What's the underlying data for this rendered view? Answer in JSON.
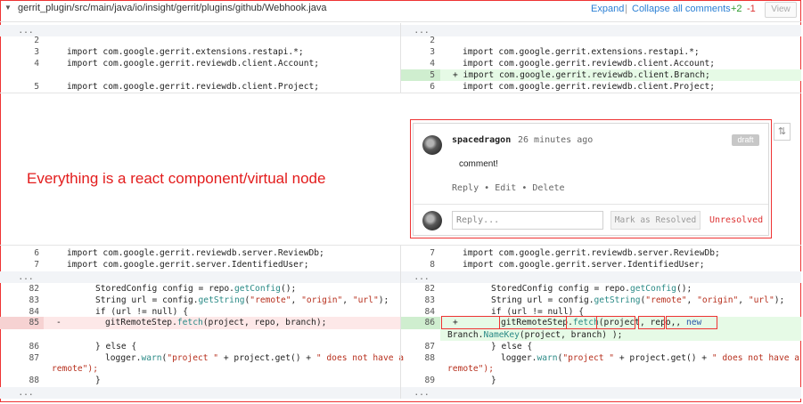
{
  "header": {
    "file_path": "gerrit_plugin/src/main/java/io/insight/gerrit/plugins/github/Webhook.java",
    "expand_label": "Expand",
    "separator": "|",
    "collapse_label": "Collapse all comments",
    "additions": "+2",
    "deletions": "-1",
    "view_label": "View"
  },
  "skip_label": "...",
  "left": {
    "lines": [
      {
        "n": "2",
        "code": ""
      },
      {
        "n": "3",
        "code": "import com.google.gerrit.extensions.restapi.*;"
      },
      {
        "n": "4",
        "code": "import com.google.gerrit.reviewdb.client.Account;"
      },
      {
        "n": "5",
        "code": "import com.google.gerrit.reviewdb.client.Project;"
      },
      {
        "n": "6",
        "code": "import com.google.gerrit.reviewdb.server.ReviewDb;"
      },
      {
        "n": "7",
        "code": "import com.google.gerrit.server.IdentifiedUser;"
      },
      {
        "n": "82",
        "code": "StoredConfig config = repo."
      },
      {
        "n": "83",
        "code": "String url = config."
      },
      {
        "n": "84",
        "code": "if (url != null) {"
      },
      {
        "n": "85",
        "code": "gitRemoteStep."
      },
      {
        "n": "86",
        "code": "} else {"
      },
      {
        "n": "87",
        "code": "logger."
      },
      {
        "n": "88",
        "code": "}"
      }
    ]
  },
  "right": {
    "lines": [
      {
        "n": "2",
        "code": ""
      },
      {
        "n": "3",
        "code": "import com.google.gerrit.extensions.restapi.*;"
      },
      {
        "n": "4",
        "code": "import com.google.gerrit.reviewdb.client.Account;"
      },
      {
        "n": "5",
        "code": "+ import com.google.gerrit.reviewdb.client.Branch;"
      },
      {
        "n": "6",
        "code": "import com.google.gerrit.reviewdb.client.Project;"
      },
      {
        "n": "7",
        "code": "import com.google.gerrit.reviewdb.server.ReviewDb;"
      },
      {
        "n": "8",
        "code": "import com.google.gerrit.server.IdentifiedUser;"
      },
      {
        "n": "82",
        "code": "StoredConfig config = repo."
      },
      {
        "n": "83",
        "code": "String url = config."
      },
      {
        "n": "84",
        "code": "if (url != null) {"
      },
      {
        "n": "86",
        "code": "+"
      },
      {
        "n": "87",
        "code": "} else {"
      },
      {
        "n": "88",
        "code": "logger."
      },
      {
        "n": "89",
        "code": "}"
      }
    ]
  },
  "tokens": {
    "getConfig": "getConfig",
    "config_tail": "();",
    "getString": "getString",
    "str_remote": "\"remote\"",
    "str_origin": "\"origin\"",
    "str_url": "\"url\"",
    "comma": ", ",
    "open": "(",
    "close_semi": ");",
    "null_kw": "null",
    "fetch": "fetch",
    "fetch_args": "(project, repo, branch);",
    "minus": "-",
    "warn": "warn",
    "str_project": "\"project \"",
    "plus_proj": " + project.",
    "get_call": "get",
    "paren_pair": "()",
    "plus": " + ",
    "str_not_have": "\" does not have a",
    "remote_tail": "remote\");",
    "right_gitRemoteStep": "gitRemoteStep",
    "right_dot": ".",
    "right_fetch": "fetch",
    "right_project": "(project,",
    "right_repo": " repo,",
    "right_new": "new",
    "right_branch_ns": "Branch.",
    "right_namekey": "NameKey",
    "right_tail": "(project, branch) );"
  },
  "comment": {
    "author": "spacedragon",
    "time": "26 minutes ago",
    "badge": "draft",
    "text": "comment!",
    "reply": "Reply",
    "edit": "Edit",
    "delete": "Delete",
    "dot": "•",
    "reply_placeholder": "Reply...",
    "mark_resolved": "Mark as Resolved",
    "unresolved": "Unresolved",
    "collapse_icon": "collapse-icon"
  },
  "annotation": "Everything is a react component/virtual node"
}
